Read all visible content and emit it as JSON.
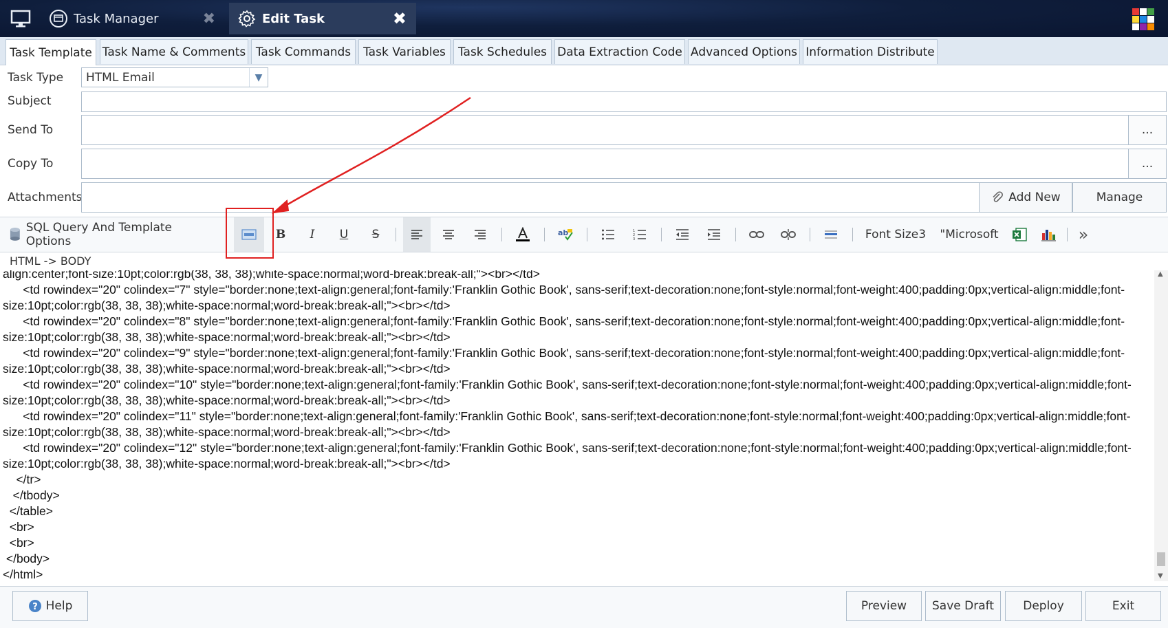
{
  "window": {
    "tabs": [
      {
        "label": "Task Manager",
        "icon": "task-manager-icon",
        "active": false
      },
      {
        "label": "Edit Task",
        "icon": "gear-icon",
        "active": true
      }
    ],
    "close_glyph": "✖"
  },
  "task_tabs": [
    {
      "label": "Task Template",
      "active": true
    },
    {
      "label": "Task Name & Comments"
    },
    {
      "label": "Task Commands"
    },
    {
      "label": "Task Variables"
    },
    {
      "label": "Task Schedules"
    },
    {
      "label": "Data Extraction Code"
    },
    {
      "label": "Advanced Options"
    },
    {
      "label": "Information Distribute"
    }
  ],
  "form": {
    "task_type_label": "Task Type",
    "task_type_value": "HTML Email",
    "subject_label": "Subject",
    "send_to_label": "Send To",
    "copy_to_label": "Copy To",
    "attachments_label": "Attachments",
    "browse_glyph": "...",
    "add_new_label": "Add New",
    "manage_label": "Manage"
  },
  "toolbar": {
    "sql_options_label": "SQL Query And Template Options",
    "font_size_label": "Font Size3",
    "font_name_label": "\"Microsoft",
    "bold": "B",
    "italic": "I",
    "underline": "U",
    "strike": "S",
    "more_glyph": "»"
  },
  "breadcrumb": "HTML  ->  BODY",
  "editor": {
    "code": "align:center;font-size:10pt;color:rgb(38, 38, 38);white-space:normal;word-break:break-all;\"><br></td>\n      <td rowindex=\"20\" colindex=\"7\" style=\"border:none;text-align:general;font-family:'Franklin Gothic Book', sans-serif;text-decoration:none;font-style:normal;font-weight:400;padding:0px;vertical-align:middle;font-size:10pt;color:rgb(38, 38, 38);white-space:normal;word-break:break-all;\"><br></td>\n      <td rowindex=\"20\" colindex=\"8\" style=\"border:none;text-align:general;font-family:'Franklin Gothic Book', sans-serif;text-decoration:none;font-style:normal;font-weight:400;padding:0px;vertical-align:middle;font-size:10pt;color:rgb(38, 38, 38);white-space:normal;word-break:break-all;\"><br></td>\n      <td rowindex=\"20\" colindex=\"9\" style=\"border:none;text-align:general;font-family:'Franklin Gothic Book', sans-serif;text-decoration:none;font-style:normal;font-weight:400;padding:0px;vertical-align:middle;font-size:10pt;color:rgb(38, 38, 38);white-space:normal;word-break:break-all;\"><br></td>\n      <td rowindex=\"20\" colindex=\"10\" style=\"border:none;text-align:general;font-family:'Franklin Gothic Book', sans-serif;text-decoration:none;font-style:normal;font-weight:400;padding:0px;vertical-align:middle;font-size:10pt;color:rgb(38, 38, 38);white-space:normal;word-break:break-all;\"><br></td>\n      <td rowindex=\"20\" colindex=\"11\" style=\"border:none;text-align:general;font-family:'Franklin Gothic Book', sans-serif;text-decoration:none;font-style:normal;font-weight:400;padding:0px;vertical-align:middle;font-size:10pt;color:rgb(38, 38, 38);white-space:normal;word-break:break-all;\"><br></td>\n      <td rowindex=\"20\" colindex=\"12\" style=\"border:none;text-align:general;font-family:'Franklin Gothic Book', sans-serif;text-decoration:none;font-style:normal;font-weight:400;padding:0px;vertical-align:middle;font-size:10pt;color:rgb(38, 38, 38);white-space:normal;word-break:break-all;\"><br></td>\n    </tr>\n   </tbody>\n  </table>\n  <br>\n  <br>\n </body>\n</html>"
  },
  "footer": {
    "help_label": "Help",
    "preview_label": "Preview",
    "save_draft_label": "Save Draft",
    "deploy_label": "Deploy",
    "exit_label": "Exit"
  },
  "colors": {
    "annotation": "#e02020",
    "title_bar": "#0f1e3c",
    "active_tab": "#2b3c5c"
  }
}
